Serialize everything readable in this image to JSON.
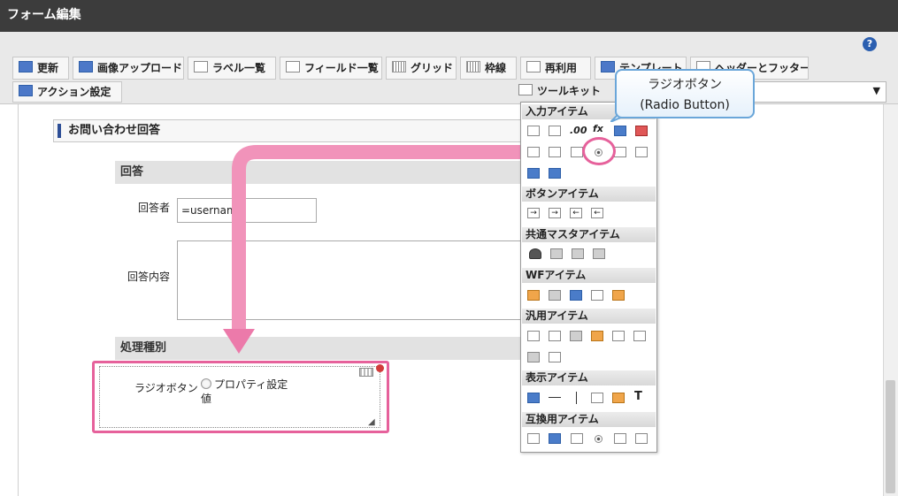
{
  "window": {
    "title": "フォーム編集"
  },
  "toolbar": {
    "help_label": "?",
    "tabs_row1": [
      {
        "label": "更新",
        "icon": "save-icon"
      },
      {
        "label": "画像アップロード",
        "icon": "image-upload-icon"
      },
      {
        "label": "ラベル一覧",
        "icon": "label-list-icon"
      },
      {
        "label": "フィールド一覧",
        "icon": "field-list-icon"
      },
      {
        "label": "グリッド",
        "icon": "grid-icon"
      },
      {
        "label": "枠線",
        "icon": "border-icon"
      },
      {
        "label": "再利用",
        "icon": "reuse-icon"
      },
      {
        "label": "テンプレート",
        "icon": "template-icon"
      },
      {
        "label": "ヘッダーとフッター",
        "icon": "header-footer-icon"
      }
    ],
    "tabs_row2": [
      {
        "label": "アクション設定",
        "icon": "action-icon"
      },
      {
        "label": "ツールキット",
        "icon": "toolkit-icon"
      }
    ],
    "combo_arrow": "▼"
  },
  "form": {
    "title": "お問い合わせ回答",
    "section_answer": "回答",
    "respondent_label": "回答者",
    "respondent_value": "=usernam",
    "content_label": "回答内容",
    "section_type": "処理種別",
    "radio_label": "ラジオボタン",
    "radio_option": "プロパティ設定",
    "radio_option_line2": "値"
  },
  "toolkit": {
    "groups": [
      "入力アイテム",
      "ボタンアイテム",
      "共通マスタアイテム",
      "WFアイテム",
      "汎用アイテム",
      "表示アイテム",
      "互換用アイテム"
    ]
  },
  "callout": {
    "line1": "ラジオボタン",
    "line2": "(Radio Button)"
  },
  "colors": {
    "highlight": "#e6619b",
    "titlebar": "#3c3c3c",
    "callout_border": "#6aa6d9"
  }
}
